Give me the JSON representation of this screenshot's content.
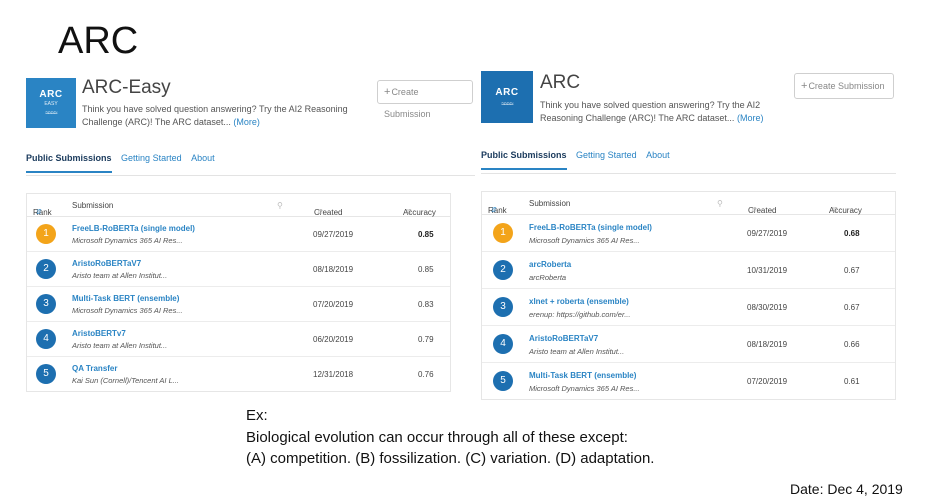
{
  "slide": {
    "title": "ARC",
    "example_lines": [
      "Ex:",
      "Biological evolution can occur through all of these except:",
      "(A) competition. (B) fossilization. (C) variation. (D) adaptation."
    ],
    "date": "Date: Dec 4, 2019"
  },
  "colors": {
    "accent": "#2a84c4",
    "rank_gold": "#f3a41a",
    "rank_blue": "#1d6fb0"
  },
  "left": {
    "logo": {
      "text": "ARC",
      "sub": "EASY"
    },
    "title": "ARC-Easy",
    "description": "Think you have solved question answering? Try the AI2 Reasoning Challenge (ARC)! The ARC dataset...",
    "more": "(More)",
    "create_button": "Create Submission",
    "tabs": [
      "Public Submissions",
      "Getting Started",
      "About"
    ],
    "columns": {
      "rank": "Rank",
      "submission": "Submission",
      "created": "Created",
      "accuracy": "Accuracy"
    },
    "rows": [
      {
        "rank": "1",
        "name": "FreeLB-RoBERTa (single model)",
        "org": "Microsoft Dynamics 365 AI Res...",
        "created": "09/27/2019",
        "accuracy": "0.85"
      },
      {
        "rank": "2",
        "name": "AristoRoBERTaV7",
        "org": "Aristo team at Allen Institut...",
        "created": "08/18/2019",
        "accuracy": "0.85"
      },
      {
        "rank": "3",
        "name": "Multi-Task BERT (ensemble)",
        "org": "Microsoft Dynamics 365 AI Res...",
        "created": "07/20/2019",
        "accuracy": "0.83"
      },
      {
        "rank": "4",
        "name": "AristoBERTv7",
        "org": "Aristo team at Allen Institut...",
        "created": "06/20/2019",
        "accuracy": "0.79"
      },
      {
        "rank": "5",
        "name": "QA Transfer",
        "org": "Kai Sun (Cornell)/Tencent AI L...",
        "created": "12/31/2018",
        "accuracy": "0.76"
      }
    ]
  },
  "right": {
    "logo": {
      "text": "ARC"
    },
    "title": "ARC",
    "description": "Think you have solved question answering? Try the AI2 Reasoning Challenge (ARC)! The ARC dataset...",
    "more": "(More)",
    "create_button": "Create Submission",
    "tabs": [
      "Public Submissions",
      "Getting Started",
      "About"
    ],
    "columns": {
      "rank": "Rank",
      "submission": "Submission",
      "created": "Created",
      "accuracy": "Accuracy"
    },
    "rows": [
      {
        "rank": "1",
        "name": "FreeLB-RoBERTa (single model)",
        "org": "Microsoft Dynamics 365 AI Res...",
        "created": "09/27/2019",
        "accuracy": "0.68"
      },
      {
        "rank": "2",
        "name": "arcRoberta",
        "org": "arcRoberta",
        "created": "10/31/2019",
        "accuracy": "0.67"
      },
      {
        "rank": "3",
        "name": "xlnet + roberta (ensemble)",
        "org": "erenup: https://github.com/er...",
        "created": "08/30/2019",
        "accuracy": "0.67"
      },
      {
        "rank": "4",
        "name": "AristoRoBERTaV7",
        "org": "Aristo team at Allen Institut...",
        "created": "08/18/2019",
        "accuracy": "0.66"
      },
      {
        "rank": "5",
        "name": "Multi-Task BERT (ensemble)",
        "org": "Microsoft Dynamics 365 AI Res...",
        "created": "07/20/2019",
        "accuracy": "0.61"
      }
    ]
  }
}
